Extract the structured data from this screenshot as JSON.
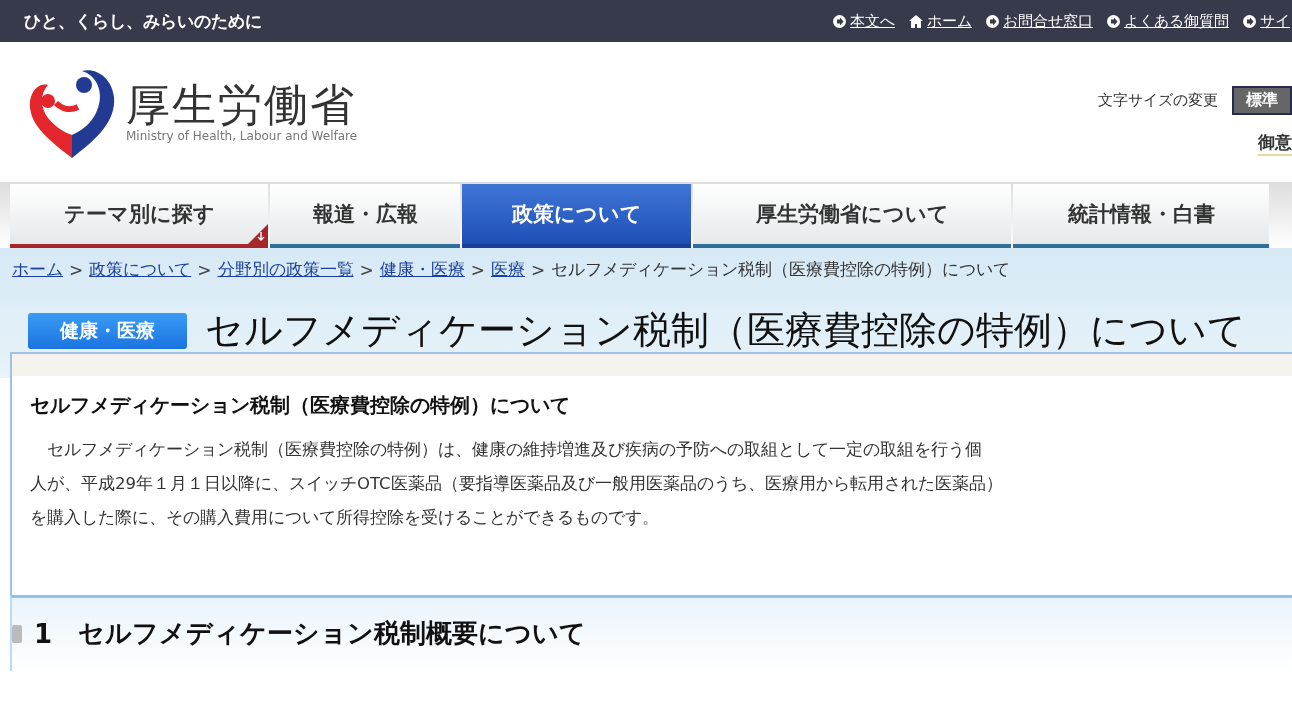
{
  "top_bar": {
    "tagline": "ひと、くらし、みらいのために",
    "links": [
      {
        "kind": "arrow",
        "label": "本文へ"
      },
      {
        "kind": "home",
        "label": "ホーム"
      },
      {
        "kind": "arrow",
        "label": "お問合せ窓口"
      },
      {
        "kind": "arrow",
        "label": "よくある御質問"
      },
      {
        "kind": "arrow",
        "label": "サイ"
      }
    ]
  },
  "header": {
    "logo_title": "厚生労働省",
    "logo_subtitle": "Ministry of Health, Labour and Welfare",
    "font_size_label": "文字サイズの変更",
    "font_size_button": "標準",
    "cut_link": "御意"
  },
  "nav": [
    {
      "label": "テーマ別に探す",
      "selected": false,
      "kind": "menu"
    },
    {
      "label": "報道・広報",
      "selected": false,
      "kind": "plain"
    },
    {
      "label": "政策について",
      "selected": true,
      "kind": "plain"
    },
    {
      "label": "厚生労働省について",
      "selected": false,
      "kind": "plain"
    },
    {
      "label": "統計情報・白書",
      "selected": false,
      "kind": "plain"
    }
  ],
  "breadcrumb": {
    "links": [
      {
        "label": "ホーム",
        "separator": ">"
      },
      {
        "label": "政策について",
        "separator": ">"
      },
      {
        "label": "分野別の政策一覧",
        "separator": ">"
      },
      {
        "label": "健康・医療",
        "separator": ">"
      },
      {
        "label": "医療",
        "separator": ">"
      }
    ],
    "current": "セルフメディケーション税制（医療費控除の特例）について"
  },
  "page_title": {
    "category": "健康・医療",
    "title": "セルフメディケーション税制（医療費控除の特例）について"
  },
  "content": {
    "heading": "セルフメディケーション税制（医療費控除の特例）について",
    "body_lines": [
      "　セルフメディケーション税制（医療費控除の特例）は、健康の維持増進及び疾病の予防への取組として一定の取組を行う個",
      "人が、平成29年１月１日以降に、スイッチOTC医薬品（要指導医薬品及び一般用医薬品のうち、医療用から転用された医薬品）",
      "を購入した際に、その購入費用について所得控除を受けることができるものです。"
    ]
  },
  "section": {
    "number": "1",
    "title": "セルフメディケーション税制概要について"
  }
}
